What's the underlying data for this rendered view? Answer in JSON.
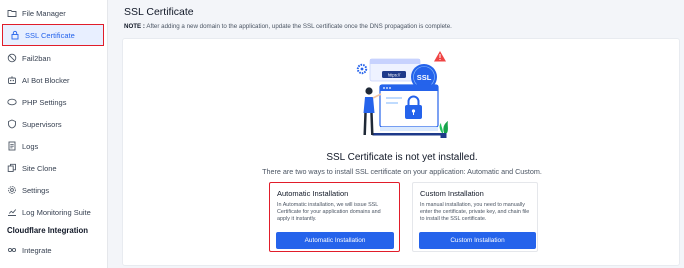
{
  "sidebar": {
    "items": [
      {
        "label": "File Manager",
        "icon": "folder-icon"
      },
      {
        "label": "SSL Certificate",
        "icon": "lock-icon"
      },
      {
        "label": "Fail2ban",
        "icon": "ban-icon"
      },
      {
        "label": "AI Bot Blocker",
        "icon": "robot-icon"
      },
      {
        "label": "PHP Settings",
        "icon": "php-icon"
      },
      {
        "label": "Supervisors",
        "icon": "supervisor-icon"
      },
      {
        "label": "Logs",
        "icon": "logs-icon"
      },
      {
        "label": "Site Clone",
        "icon": "clone-icon"
      },
      {
        "label": "Settings",
        "icon": "gear-icon"
      },
      {
        "label": "Log Monitoring Suite",
        "icon": "monitor-icon"
      }
    ],
    "section_title": "Cloudflare Integration",
    "section_items": [
      {
        "label": "Integrate",
        "icon": "integrate-icon"
      }
    ]
  },
  "main": {
    "title": "SSL Certificate",
    "note_label": "NOTE :",
    "note_text": " After adding a new domain to the application, update the SSL certificate once the DNS propagation is complete.",
    "illustration": {
      "browser_text": "https://",
      "badge_text": "SSL"
    },
    "status_title": "SSL Certificate is not yet installed.",
    "status_subtitle": "There are two ways to install SSL certificate on your application: Automatic and Custom.",
    "options": [
      {
        "title": "Automatic Installation",
        "description": "In Automatic installation, we will issue SSL Certificate for your application domains and apply it instantly.",
        "button": "Automatic Installation"
      },
      {
        "title": "Custom Installation",
        "description": "In manual installation, you need to manually enter the certificate, private key, and chain file to install the SSL certificate.",
        "button": "Custom Installation"
      }
    ]
  },
  "colors": {
    "accent": "#2563eb",
    "highlight": "#e11d2a",
    "active_bg": "#e8efff"
  }
}
